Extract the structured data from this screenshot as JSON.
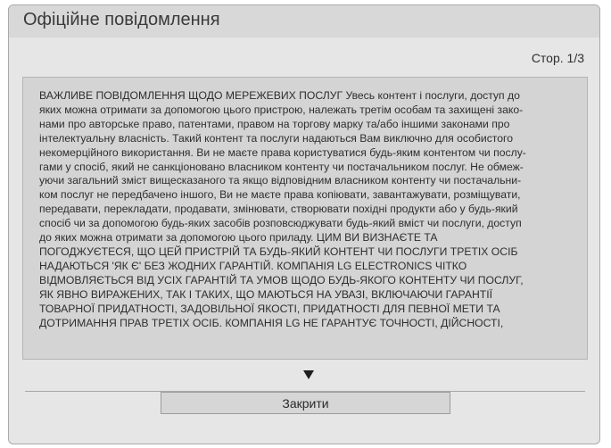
{
  "dialog": {
    "title": "Офіційне повідомлення",
    "page_indicator": "Стор. 1/3",
    "content_text": "ВАЖЛИВЕ ПОВІДОМЛЕННЯ ЩОДО МЕРЕЖЕВИХ ПОСЛУГ Увесь контент і послуги, доступ до\nяких можна отримати за допомогою цього пристрою, належать третім особам та захищені зако-\nнами про авторське право, патентами, правом на торгову марку та/або іншими законами про\nінтелектуальну власність. Такий контент та послуги надаються Вам виключно для особистого\nнекомерційного використання. Ви не маєте права користуватися будь-яким контентом чи послу-\nгами у спосіб, який не санкціоновано власником контенту чи постачальником послуг. Не обмеж-\nуючи загальний зміст вищесказаного та якщо відповідним власником контенту чи постачальни-\nком послуг не передбачено іншого, Ви не маєте права копіювати, завантажувати, розміщувати,\nпередавати, перекладати, продавати, змінювати, створювати похідні продукти або у будь-який\nспосіб чи за допомогою будь-яких засобів розповсюджувати будь-який вміст чи послуги, доступ\nдо яких можна отримати за допомогою цього приладу. ЦИМ ВИ ВИЗНАЄТЕ ТА\nПОГОДЖУЄТЕСЯ, ЩО ЦЕЙ ПРИСТРІЙ ТА БУДЬ-ЯКИЙ КОНТЕНТ ЧИ ПОСЛУГИ ТРЕТІХ ОСІБ\nНАДАЮТЬСЯ 'ЯК Є' БЕЗ ЖОДНИХ ГАРАНТІЙ. КОМПАНІЯ LG ELECTRONICS ЧІТКО\nВІДМОВЛЯЄТЬСЯ ВІД УСІХ ГАРАНТІЙ ТА УМОВ ЩОДО БУДЬ-ЯКОГО КОНТЕНТУ ЧИ ПОСЛУГ,\nЯК ЯВНО ВИРАЖЕНИХ, ТАК І ТАКИХ, ЩО МАЮТЬСЯ НА УВАЗІ, ВКЛЮЧАЮЧИ ГАРАНТІЇ\nТОВАРНОЇ ПРИДАТНОСТІ, ЗАДОВІЛЬНОЇ ЯКОСТІ, ПРИДАТНОСТІ ДЛЯ ПЕВНОЇ МЕТИ ТА\nДОТРИМАННЯ ПРАВ ТРЕТІХ ОСІБ. КОМПАНІЯ LG НЕ ГАРАНТУЄ ТОЧНОСТІ, ДІЙСНОСТІ,",
    "scroll_icon": "triangle-down-icon",
    "close_label": "Закрити"
  }
}
